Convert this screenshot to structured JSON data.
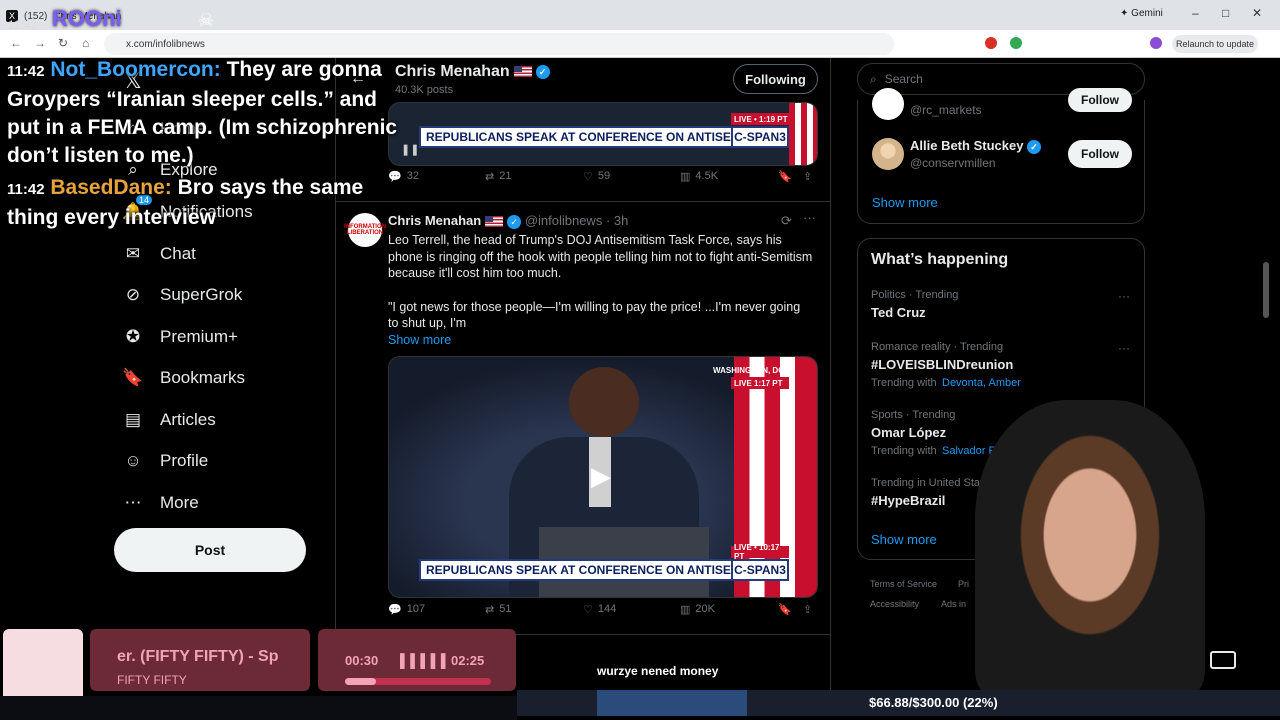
{
  "browser": {
    "tab_count": "(152)",
    "tab_title": "Chris Menahan",
    "gemini": "Gemini",
    "url": "x.com/infolibnews",
    "relaunch": "Relaunch to update"
  },
  "nav": {
    "items": [
      {
        "label": "Home",
        "icon": "home-icon"
      },
      {
        "label": "Explore",
        "icon": "search-icon"
      },
      {
        "label": "Notifications",
        "icon": "bell-icon"
      },
      {
        "label": "Chat",
        "icon": "chat-icon"
      },
      {
        "label": "SuperGrok",
        "icon": "grok-icon"
      },
      {
        "label": "Premium+",
        "icon": "premium-icon"
      },
      {
        "label": "Bookmarks",
        "icon": "bookmark-icon"
      },
      {
        "label": "Articles",
        "icon": "articles-icon"
      },
      {
        "label": "Profile",
        "icon": "profile-icon"
      },
      {
        "label": "More",
        "icon": "more-icon"
      }
    ],
    "notif_badge": "14",
    "post_label": "Post"
  },
  "profile_header": {
    "name": "Chris Menahan",
    "posts": "40.3K posts",
    "following_label": "Following"
  },
  "tweet1": {
    "chyron": "REPUBLICANS SPEAK AT CONFERENCE ON ANTISEMITISM",
    "cspan": "C-SPAN3",
    "live": "LIVE • 1:19 PT",
    "replies": "32",
    "reposts": "21",
    "likes": "59",
    "views": "4.5K"
  },
  "tweet2": {
    "name": "Chris Menahan",
    "handle": "@infolibnews",
    "time": "· 3h",
    "text1": "Leo Terrell, the head of Trump's DOJ Antisemitism Task Force, says his phone is ringing off the hook with people telling him not to fight anti-Semitism because it'll cost him too much.",
    "text2": "\"I got news for those people—I'm willing to pay the price! ...I'm never going to shut up, I'm",
    "show_more": "Show more",
    "avatar_text": "INFORMATION LIBERATION",
    "location": "WASHINGTON, DC",
    "live_top": "LIVE 1:17 PT",
    "live_bottom": "LIVE • 10:17 PT",
    "chyron": "REPUBLICANS SPEAK AT CONFERENCE ON ANTISEMITISM",
    "cspan": "C-SPAN3",
    "replies": "107",
    "reposts": "51",
    "likes": "144",
    "views": "20K"
  },
  "right": {
    "search_placeholder": "Search",
    "who_to_follow": [
      {
        "name": "",
        "handle": "@rc_markets",
        "follow": "Follow"
      },
      {
        "name": "Allie Beth Stuckey",
        "handle": "@conservmillen",
        "follow": "Follow"
      }
    ],
    "show_more": "Show more",
    "happening_title": "What’s happening",
    "trends": [
      {
        "context": "Politics · Trending",
        "topic": "Ted Cruz",
        "sub": "",
        "sub_link": ""
      },
      {
        "context": "Romance reality · Trending",
        "topic": "#LOVEISBLINDreunion",
        "sub": "Trending with",
        "sub_link": "Devonta, Amber"
      },
      {
        "context": "Sports · Trending",
        "topic": "Omar López",
        "sub": "Trending with",
        "sub_link": "Salvador Pére"
      },
      {
        "context": "Trending in United States",
        "topic": "#HypeBrazil",
        "sub": "",
        "sub_link": ""
      }
    ],
    "trends_show_more": "Show more",
    "footer1": "Terms of Service",
    "footer1b": "Pri",
    "footer2": "Accessibility",
    "footer2b": "Ads in"
  },
  "overlay": {
    "streamer": "ROOni",
    "time_top": "11:42",
    "chat": [
      {
        "time": "11:42",
        "user": "Not_Boomercon:",
        "msg": "They are gonna Groypers “Iranian sleeper cells.” and put in a FEMA camp. (Im schizophrenic don’t listen to me.)"
      },
      {
        "time": "11:42",
        "user": "BasedDane:",
        "msg": "Bro says the same thing every interview"
      }
    ],
    "song_title": "er. (FIFTY FIFTY) - Sp",
    "song_artist": "FIFTY FIFTY",
    "elapsed": "00:30",
    "total": "02:25",
    "progress": 0.21,
    "caption": "wurzye nened money",
    "goal": "$66.88/$300.00 (22%)",
    "goal_fraction": 0.22
  }
}
